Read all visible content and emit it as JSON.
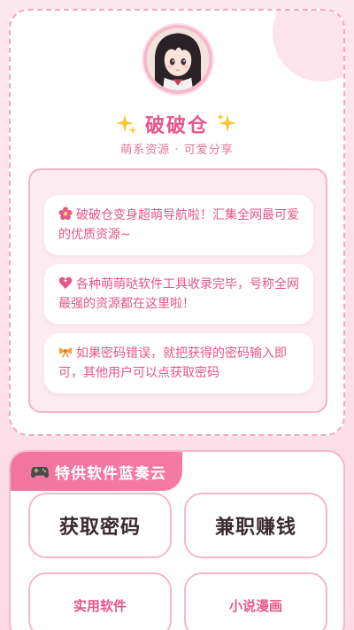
{
  "profile": {
    "avatar_icon": "anime-girl-avatar",
    "title": "破破仓",
    "subtitle": "萌系资源 · 可爱分享"
  },
  "notices": [
    {
      "icon": "flower-icon",
      "text": "破破仓变身超萌导航啦！汇集全网最可爱的优质资源~"
    },
    {
      "icon": "sparkling-heart-icon",
      "text": "各种萌萌哒软件工具收录完毕，号称全网最强的资源都在这里啦！"
    },
    {
      "icon": "ribbon-icon",
      "text": "如果密码错误，就把获得的密码输入即可，其他用户可以点获取密码"
    }
  ],
  "software_panel": {
    "tag_icon": "gamepad-icon",
    "tag_label": "特供软件蓝奏云",
    "buttons": {
      "get_password": "获取密码",
      "part_time": "兼职赚钱",
      "utility_software": "实用软件",
      "novel_comics": "小说漫画"
    }
  },
  "colors": {
    "accent": "#e8568b",
    "border_pink": "#f6b7ca",
    "tag_pink": "#f2749f",
    "background": "#fde7ef"
  }
}
